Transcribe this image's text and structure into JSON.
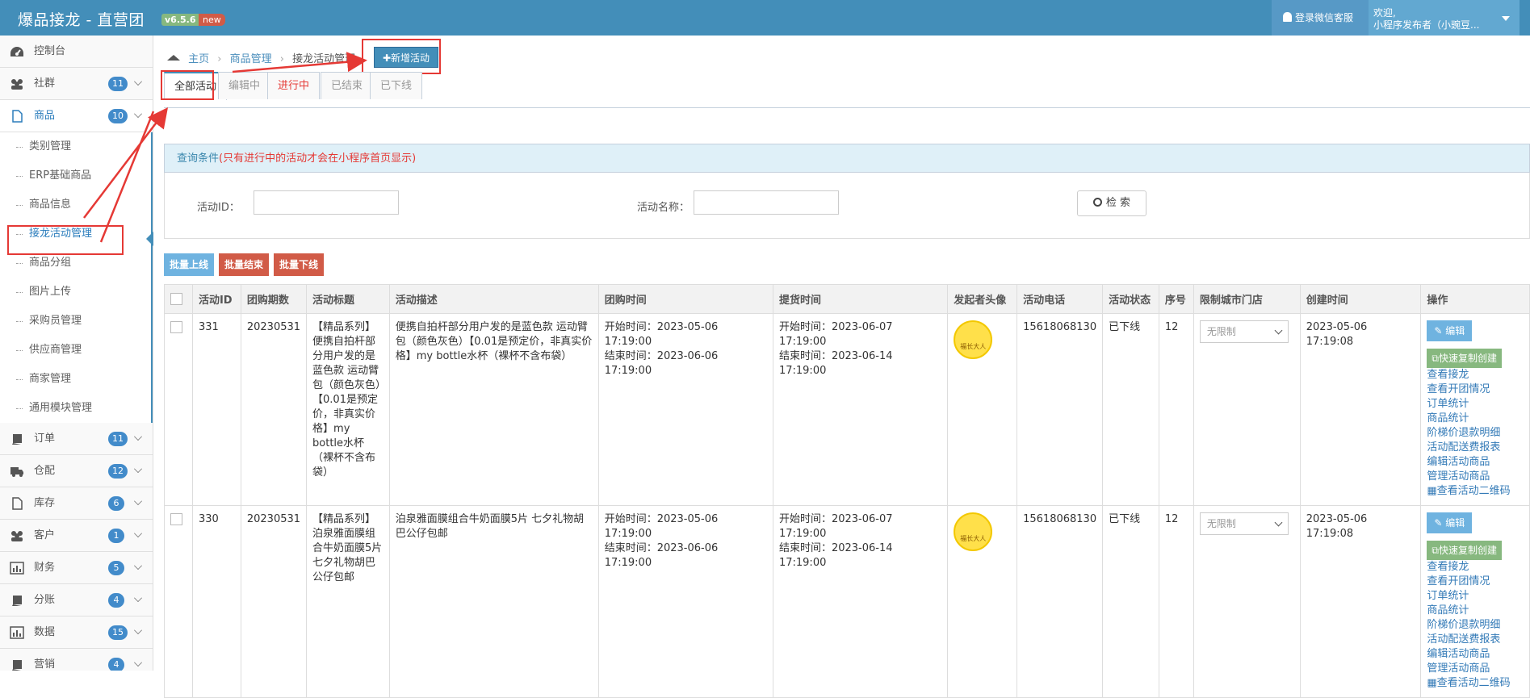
{
  "header": {
    "brand": "爆品接龙 - 直营团",
    "version": "v6.5.6",
    "new_badge": "new",
    "service_label": "登录微信客服",
    "welcome_line1": "欢迎,",
    "welcome_line2": "小程序发布者（小豌豆..."
  },
  "sidebar": {
    "items": [
      {
        "label": "控制台",
        "icon": "dashboard-icon"
      },
      {
        "label": "社群",
        "badge": "11",
        "icon": "users-icon"
      },
      {
        "label": "商品",
        "badge": "10",
        "icon": "file-icon"
      },
      {
        "label": "订单",
        "badge": "11",
        "icon": "book-icon"
      },
      {
        "label": "仓配",
        "badge": "12",
        "icon": "truck-icon"
      },
      {
        "label": "库存",
        "badge": "6",
        "icon": "file-icon"
      },
      {
        "label": "客户",
        "badge": "1",
        "icon": "users-icon"
      },
      {
        "label": "财务",
        "badge": "5",
        "icon": "chart-icon"
      },
      {
        "label": "分账",
        "badge": "4",
        "icon": "book-icon"
      },
      {
        "label": "数据",
        "badge": "15",
        "icon": "chart-icon"
      },
      {
        "label": "营销",
        "badge": "4",
        "icon": "book-icon"
      }
    ],
    "sub_items": [
      "类别管理",
      "ERP基础商品",
      "商品信息",
      "接龙活动管理",
      "商品分组",
      "图片上传",
      "采购员管理",
      "供应商管理",
      "商家管理",
      "通用模块管理"
    ]
  },
  "breadcrumb": {
    "home": "主页",
    "level1": "商品管理",
    "level2": "接龙活动管理"
  },
  "add_button": "新增活动",
  "tabs": [
    "全部活动",
    "编辑中",
    "进行中",
    "已结束",
    "已下线"
  ],
  "query": {
    "title": "查询条件",
    "note": "(只有进行中的活动才会在小程序首页显示)",
    "id_label": "活动ID：",
    "name_label": "活动名称：",
    "search_button": "检 索"
  },
  "batch": {
    "online": "批量上线",
    "end": "批量结束",
    "offline": "批量下线"
  },
  "colors": {
    "topbar": "#438eb9",
    "online": "#6fb3e0",
    "end": "#d15b47",
    "red_tab": "#e53935",
    "copy": "#87b87f"
  },
  "table": {
    "headers": [
      "活动ID",
      "团购期数",
      "活动标题",
      "活动描述",
      "团购时间",
      "提货时间",
      "发起者头像",
      "活动电话",
      "活动状态",
      "序号",
      "限制城市门店",
      "创建时间",
      "操作"
    ],
    "rows": [
      {
        "id": "331",
        "period": "20230531",
        "title": "【精品系列】便携自拍杆部分用户发的是蓝色款 运动臂包（颜色灰色）【0.01是预定价，非真实价格】my bottle水杯（裸杯不含布袋）",
        "desc": "便携自拍杆部分用户发的是蓝色款 运动臂包（颜色灰色）【0.01是预定价，非真实价格】my bottle水杯（裸杯不含布袋）",
        "group_start": "开始时间：2023-05-06 17:19:00",
        "group_end": "结束时间：2023-06-06 17:19:00",
        "pick_start": "开始时间：2023-06-07 17:19:00",
        "pick_end": "结束时间：2023-06-14 17:19:00",
        "avatar_text": "福长大人",
        "phone": "15618068130",
        "status": "已下线",
        "seq": "12",
        "city": "无限制",
        "created": "2023-05-06 17:19:08"
      },
      {
        "id": "330",
        "period": "20230531",
        "title": "【精品系列】泊泉雅面膜组合牛奶面膜5片七夕礼物胡巴公仔包邮",
        "desc": "泊泉雅面膜组合牛奶面膜5片 七夕礼物胡巴公仔包邮",
        "group_start": "开始时间：2023-05-06 17:19:00",
        "group_end": "结束时间：2023-06-06 17:19:00",
        "pick_start": "开始时间：2023-06-07 17:19:00",
        "pick_end": "结束时间：2023-06-14 17:19:00",
        "avatar_text": "福长大人",
        "phone": "15618068130",
        "status": "已下线",
        "seq": "12",
        "city": "无限制",
        "created": "2023-05-06 17:19:08"
      }
    ],
    "ops": {
      "edit": "编辑",
      "copy": "快速复制创建",
      "links": [
        "查看接龙",
        "查看开团情况",
        "订单统计",
        "商品统计",
        "阶梯价退款明细",
        "活动配送费报表",
        "编辑活动商品",
        "管理活动商品",
        "查看活动二维码"
      ]
    }
  }
}
